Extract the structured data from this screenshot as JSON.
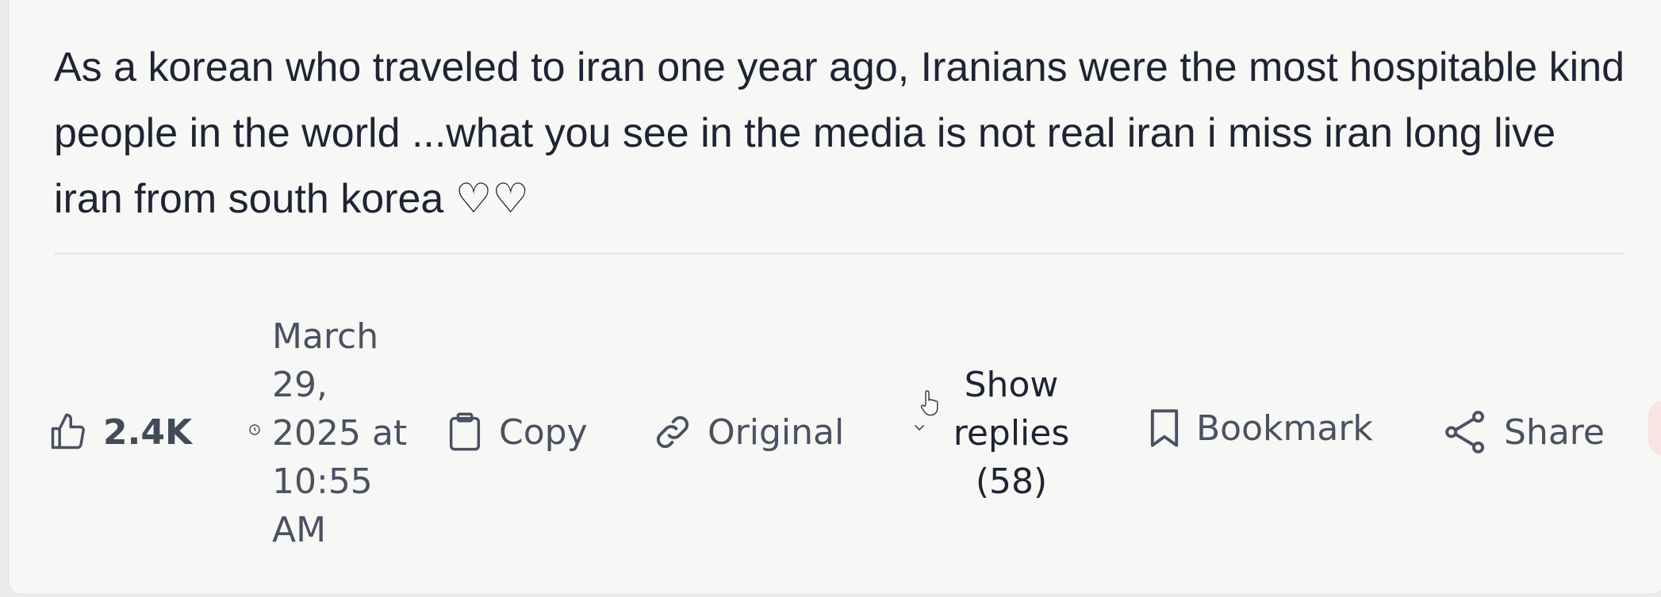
{
  "comment": {
    "text": "As a korean who traveled to iran one year ago, Iranians were the most hospitable kind people in the world ...what you see in the media is not real iran i miss iran long live iran from south korea ♡♡"
  },
  "actions": {
    "like_count": "2.4K",
    "timestamp": "March 29, 2025 at 10:55 AM",
    "copy_label": "Copy",
    "original_label": "Original",
    "show_replies_label": "Show replies (58)",
    "bookmark_label": "Bookmark",
    "share_label": "Share"
  },
  "icons": {
    "like": "thumbs-up-icon",
    "clock": "clock-icon",
    "copy": "clipboard-icon",
    "original": "link-icon",
    "replies": "chevron-down-icon",
    "cursor": "hand-cursor-icon",
    "bookmark": "bookmark-icon",
    "share": "share-icon"
  },
  "colors": {
    "text_primary": "#1e2433",
    "text_secondary": "#4a5161",
    "card_background": "#f7f7f5",
    "divider": "#e3e5ea"
  }
}
